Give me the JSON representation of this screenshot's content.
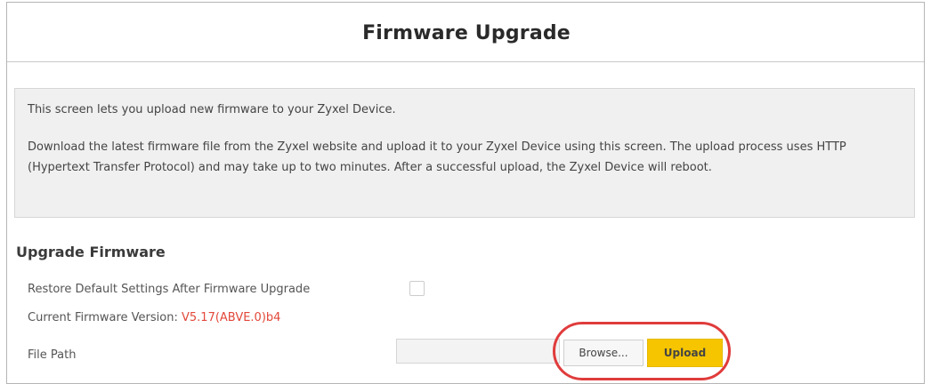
{
  "page": {
    "title": "Firmware Upgrade"
  },
  "info": {
    "line1": "This screen lets you upload new firmware to your Zyxel Device.",
    "paragraph": "Download the latest firmware file from the Zyxel website and upload it to your Zyxel Device using this screen. The upload process uses HTTP (Hypertext Transfer Protocol) and may take up to two minutes. After a successful upload, the Zyxel Device will reboot."
  },
  "upgrade_section": {
    "title": "Upgrade Firmware",
    "restore_label": "Restore Default Settings After Firmware Upgrade",
    "restore_checked": false,
    "version_label": "Current Firmware Version: ",
    "version_value": "V5.17(ABVE.0)b4",
    "file_path_label": "File Path",
    "file_path_value": "",
    "browse_label": "Browse...",
    "upload_label": "Upload"
  },
  "colors": {
    "accent_yellow": "#f6c500",
    "version_red": "#e2473a",
    "highlight_red": "#e03c3c",
    "info_box_bg": "#f0f0f0"
  }
}
